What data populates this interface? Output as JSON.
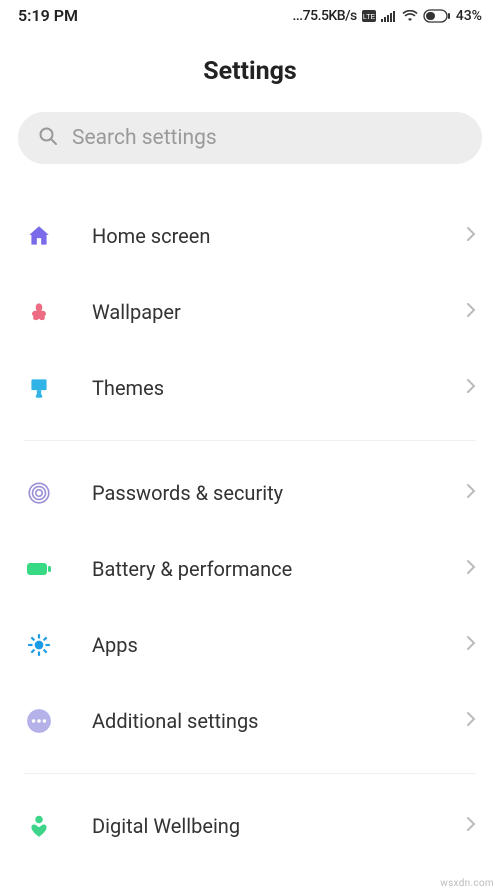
{
  "status": {
    "time": "5:19 PM",
    "net_speed": "...75.5KB/s",
    "battery_pct": "43%"
  },
  "title": "Settings",
  "search": {
    "placeholder": "Search settings"
  },
  "group1": [
    {
      "label": "Home screen"
    },
    {
      "label": "Wallpaper"
    },
    {
      "label": "Themes"
    }
  ],
  "group2": [
    {
      "label": "Passwords & security"
    },
    {
      "label": "Battery & performance"
    },
    {
      "label": "Apps"
    },
    {
      "label": "Additional settings"
    }
  ],
  "group3": [
    {
      "label": "Digital Wellbeing"
    }
  ],
  "watermark": "wsxdn.com"
}
